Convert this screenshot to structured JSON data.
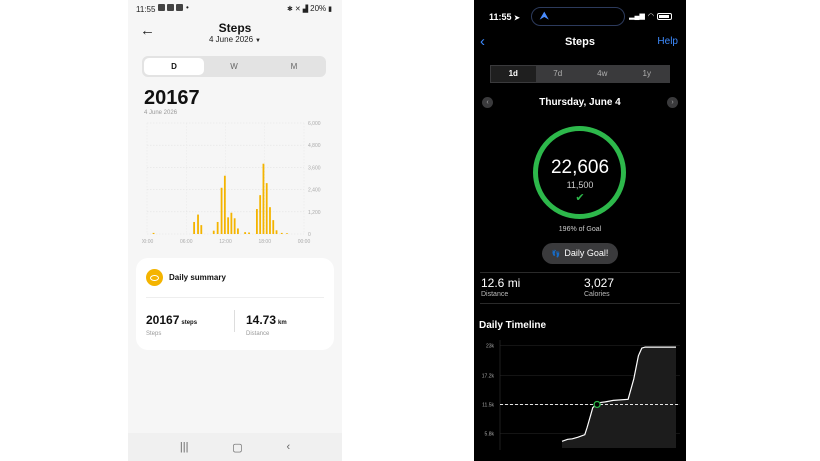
{
  "left_app": {
    "status_bar": {
      "time": "11:55",
      "battery": "20%"
    },
    "title": "Steps",
    "date_selector": "4 June 2026",
    "period_tabs": [
      "D",
      "W",
      "M"
    ],
    "active_tab": "D",
    "total_steps": "20167",
    "total_date": "4 June 2026",
    "chart_data": {
      "type": "bar",
      "color": "#f4b400",
      "x_ticks": [
        "00:00",
        "06:00",
        "12:00",
        "18:00",
        "00:00"
      ],
      "y_ticks": [
        "6,000",
        "4,800",
        "3,600",
        "2,400",
        "1,200",
        "0"
      ],
      "ylim": [
        0,
        6000
      ],
      "values": [
        {
          "t": 1.0,
          "v": 60
        },
        {
          "t": 7.2,
          "v": 650
        },
        {
          "t": 7.8,
          "v": 1050
        },
        {
          "t": 8.3,
          "v": 480
        },
        {
          "t": 10.2,
          "v": 180
        },
        {
          "t": 10.8,
          "v": 650
        },
        {
          "t": 11.4,
          "v": 2500
        },
        {
          "t": 11.9,
          "v": 3150
        },
        {
          "t": 12.4,
          "v": 900
        },
        {
          "t": 12.9,
          "v": 1150
        },
        {
          "t": 13.4,
          "v": 850
        },
        {
          "t": 13.9,
          "v": 300
        },
        {
          "t": 15.0,
          "v": 100
        },
        {
          "t": 15.6,
          "v": 80
        },
        {
          "t": 16.8,
          "v": 1350
        },
        {
          "t": 17.3,
          "v": 2100
        },
        {
          "t": 17.8,
          "v": 3800
        },
        {
          "t": 18.3,
          "v": 2750
        },
        {
          "t": 18.8,
          "v": 1450
        },
        {
          "t": 19.3,
          "v": 750
        },
        {
          "t": 19.8,
          "v": 200
        },
        {
          "t": 20.6,
          "v": 60
        },
        {
          "t": 21.4,
          "v": 40
        }
      ]
    },
    "summary": {
      "title": "Daily summary",
      "steps_value": "20167",
      "steps_unit": "steps",
      "steps_label": "Steps",
      "distance_value": "14.73",
      "distance_unit": "km",
      "distance_label": "Distance"
    },
    "nav_icons": [
      "recents-icon",
      "home-icon",
      "back-icon"
    ]
  },
  "right_app": {
    "status_bar": {
      "time": "11:55",
      "pill_icon": "navigation-arrow-icon"
    },
    "title": "Steps",
    "help_label": "Help",
    "period_tabs": [
      "1d",
      "7d",
      "4w",
      "1y"
    ],
    "active_tab": "1d",
    "day_label": "Thursday, June 4",
    "steps": "22,606",
    "goal": "11,500",
    "goal_percent": "196% of Goal",
    "badge_label": "Daily Goal!",
    "distance_value": "12.6 mi",
    "distance_label": "Distance",
    "calories_value": "3,027",
    "calories_label": "Calories",
    "timeline_title": "Daily Timeline",
    "chart_data": {
      "type": "line",
      "accent": "#2db84b",
      "y_ticks": [
        "23k",
        "17.2k",
        "11.5k",
        "5.8k"
      ],
      "ylim": [
        3000,
        23500
      ],
      "goal_line": 11500,
      "x": [
        0.0,
        0.05,
        0.09,
        0.14,
        0.2,
        0.22,
        0.25,
        0.27,
        0.3,
        0.34,
        0.38,
        0.45,
        0.58,
        0.63,
        0.67,
        0.7,
        0.73,
        0.75,
        1.0
      ],
      "y": [
        4300,
        4700,
        4800,
        5100,
        5600,
        7000,
        9300,
        10900,
        11400,
        11900,
        12000,
        12300,
        12500,
        16500,
        21000,
        22500,
        22700,
        22700,
        22700
      ]
    }
  }
}
